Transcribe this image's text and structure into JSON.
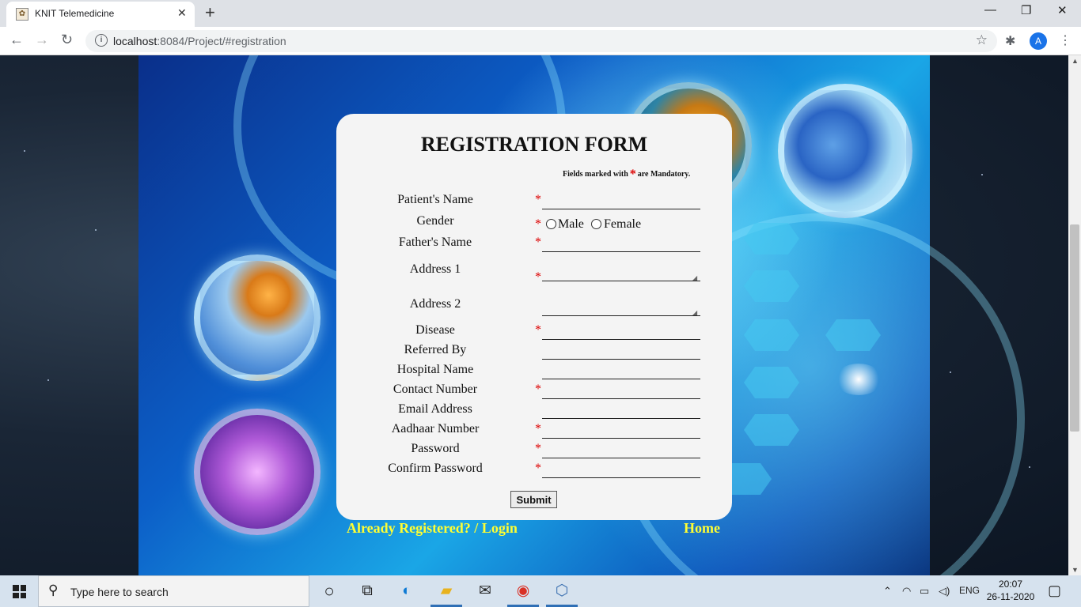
{
  "browser": {
    "tab_title": "KNIT Telemedicine",
    "tab_favicon": "knit-logo",
    "tab_close": "✕",
    "new_tab": "+",
    "window_controls": {
      "minimize": "—",
      "restore": "❐",
      "close": "✕"
    },
    "url_host": "localhost",
    "url_rest": ":8084/Project/#registration",
    "profile_initial": "A",
    "icons": [
      "back-arrow-icon",
      "forward-arrow-icon",
      "reload-icon",
      "info-icon",
      "star-icon",
      "puzzle-icon",
      "avatar",
      "menu-icon"
    ]
  },
  "form": {
    "title": "REGISTRATION FORM",
    "mandatory_prefix": "Fields marked with",
    "mandatory_star": "*",
    "mandatory_suffix": "are Mandatory.",
    "required_color": "#dd0000",
    "labels": {
      "patient_name": "Patient's Name",
      "gender": "Gender",
      "father_name": "Father's Name",
      "address1": "Address 1",
      "address2": "Address 2",
      "disease": "Disease",
      "referred_by": "Referred By",
      "hospital_name": "Hospital Name",
      "contact_number": "Contact Number",
      "email_address": "Email Address",
      "aadhaar_number": "Aadhaar Number",
      "password": "Password",
      "confirm_password": "Confirm Password"
    },
    "gender_options": {
      "male": "Male",
      "female": "Female"
    },
    "values": {
      "patient_name": "",
      "father_name": "",
      "address1": "",
      "address2": "",
      "disease": "",
      "referred_by": "",
      "hospital_name": "",
      "contact_number": "",
      "email_address": "",
      "aadhaar_number": "",
      "password": "",
      "confirm_password": ""
    },
    "submit_label": "Submit"
  },
  "links": {
    "login": "Already Registered? / Login",
    "home": "Home",
    "color": "#ffff33"
  },
  "taskbar": {
    "search_placeholder": "Type here to search",
    "language": "ENG",
    "time": "20:07",
    "date": "26-11-2020",
    "icons": [
      "windows-start-icon",
      "search-icon",
      "cortana-icon",
      "task-view-icon",
      "edge-icon",
      "file-explorer-icon",
      "mail-icon",
      "chrome-icon",
      "app-cube-icon",
      "chevron-up-icon",
      "wifi-icon",
      "battery-icon",
      "volume-icon",
      "notification-icon"
    ]
  }
}
